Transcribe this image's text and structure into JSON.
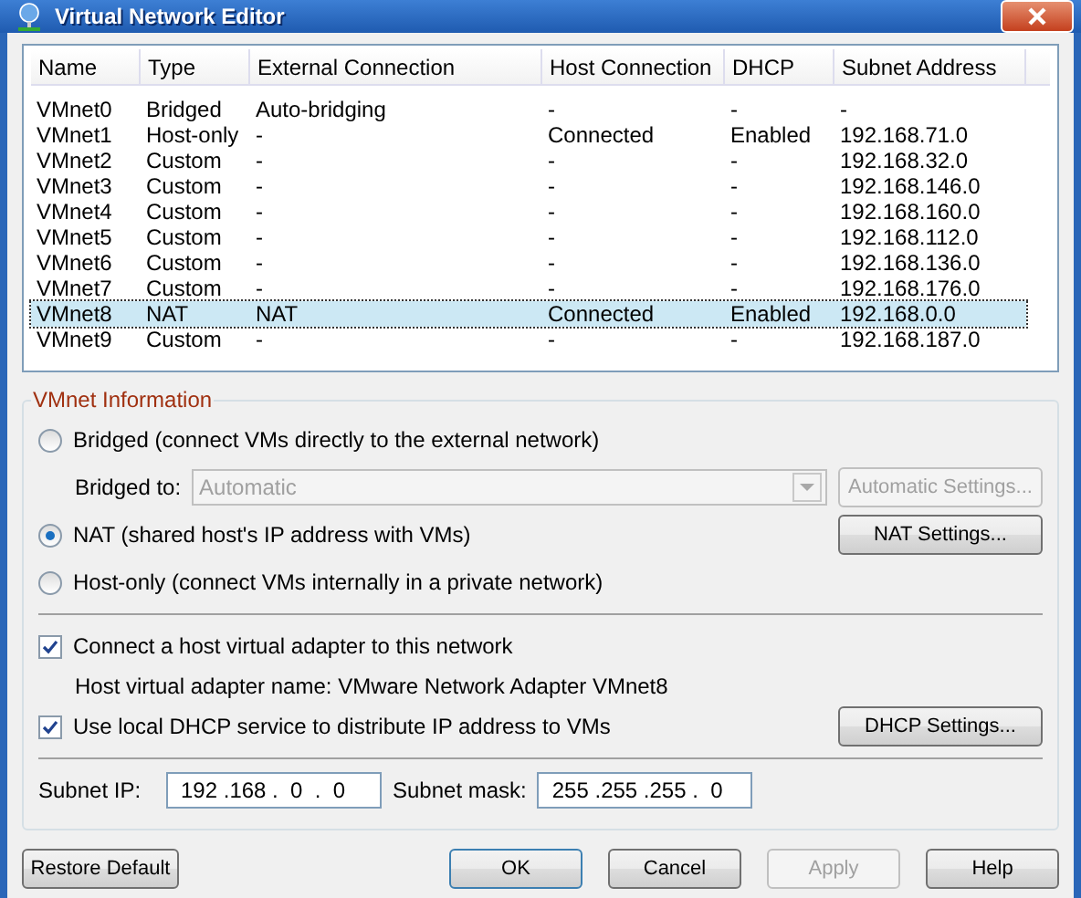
{
  "window": {
    "title": "Virtual Network Editor"
  },
  "table": {
    "columns": [
      "Name",
      "Type",
      "External Connection",
      "Host Connection",
      "DHCP",
      "Subnet Address"
    ],
    "rows": [
      {
        "cells": [
          "VMnet0",
          "Bridged",
          "Auto-bridging",
          "-",
          "-",
          "-"
        ],
        "selected": false
      },
      {
        "cells": [
          "VMnet1",
          "Host-only",
          "-",
          "Connected",
          "Enabled",
          "192.168.71.0"
        ],
        "selected": false
      },
      {
        "cells": [
          "VMnet2",
          "Custom",
          "-",
          "-",
          "-",
          "192.168.32.0"
        ],
        "selected": false
      },
      {
        "cells": [
          "VMnet3",
          "Custom",
          "-",
          "-",
          "-",
          "192.168.146.0"
        ],
        "selected": false
      },
      {
        "cells": [
          "VMnet4",
          "Custom",
          "-",
          "-",
          "-",
          "192.168.160.0"
        ],
        "selected": false
      },
      {
        "cells": [
          "VMnet5",
          "Custom",
          "-",
          "-",
          "-",
          "192.168.112.0"
        ],
        "selected": false
      },
      {
        "cells": [
          "VMnet6",
          "Custom",
          "-",
          "-",
          "-",
          "192.168.136.0"
        ],
        "selected": false
      },
      {
        "cells": [
          "VMnet7",
          "Custom",
          "-",
          "-",
          "-",
          "192.168.176.0"
        ],
        "selected": false
      },
      {
        "cells": [
          "VMnet8",
          "NAT",
          "NAT",
          "Connected",
          "Enabled",
          "192.168.0.0"
        ],
        "selected": true
      },
      {
        "cells": [
          "VMnet9",
          "Custom",
          "-",
          "-",
          "-",
          "192.168.187.0"
        ],
        "selected": false
      }
    ]
  },
  "info": {
    "title": "VMnet Information",
    "bridged": {
      "label": "Bridged (connect VMs directly to the external network)",
      "selected": false
    },
    "bridged_to": {
      "label": "Bridged to:",
      "value": "Automatic",
      "disabled": true,
      "button": {
        "label": "Automatic Settings...",
        "disabled": true
      }
    },
    "nat": {
      "label": "NAT (shared host's IP address with VMs)",
      "selected": true,
      "button": {
        "label": "NAT Settings...",
        "disabled": false
      }
    },
    "host_only": {
      "label": "Host-only (connect VMs internally in a private network)",
      "selected": false
    },
    "connect_adapter": {
      "label": "Connect a host virtual adapter to this network",
      "checked": true
    },
    "adapter_name": "Host virtual adapter name: VMware Network Adapter VMnet8",
    "use_dhcp": {
      "label": "Use local DHCP service to distribute IP address to VMs",
      "checked": true
    },
    "dhcp_button": {
      "label": "DHCP Settings...",
      "disabled": false
    },
    "subnet_ip": {
      "label": "Subnet IP:",
      "value": "192 .168 .  0  .  0"
    },
    "subnet_mask": {
      "label": "Subnet mask:",
      "value": "255 .255 .255 .  0"
    }
  },
  "buttons": {
    "restore": {
      "label": "Restore Default",
      "disabled": false
    },
    "actions": [
      {
        "label": "OK",
        "disabled": false,
        "default": true
      },
      {
        "label": "Cancel",
        "disabled": false,
        "default": false
      },
      {
        "label": "Apply",
        "disabled": true,
        "default": false
      },
      {
        "label": "Help",
        "disabled": false,
        "default": false
      }
    ]
  }
}
